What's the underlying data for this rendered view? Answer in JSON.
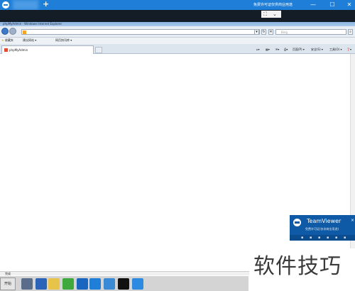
{
  "remote_toolbar": {
    "plus_label": "+",
    "title": "免费许可证仅供商业用途",
    "minimize": "—",
    "maximize": "☐",
    "close": "✕"
  },
  "remote_controls": {
    "scale": "⛶",
    "collapse": "⌄"
  },
  "ie": {
    "window_title": "phpMyAdmin - Windows Internet Explorer",
    "search_placeholder": "Bing",
    "favorites": {
      "favorites_label": "收藏夹",
      "suggested_sites": "建议网站 ▾",
      "web_slice_gallery": "网页快讯库 ▾"
    },
    "tab_label": "phpMyAdmin",
    "commands": {
      "page": "页面(P) ▾",
      "safety": "安全(S) ▾",
      "tools": "工具(O) ▾",
      "help": "❓▾"
    },
    "status_text": "完成"
  },
  "taskbar": {
    "start_label": "开始",
    "icons": [
      {
        "name": "server-manager-icon",
        "color": "#5a6d8a"
      },
      {
        "name": "powershell-icon",
        "color": "#2a63b8"
      },
      {
        "name": "explorer-icon",
        "color": "#e8c34a"
      },
      {
        "name": "green-app-icon",
        "color": "#3eaa3e"
      },
      {
        "name": "outlook-icon",
        "color": "#1a65c0"
      },
      {
        "name": "teamviewer-icon",
        "color": "#1f7fd8"
      },
      {
        "name": "remote-desktop-icon",
        "color": "#3a8ad6"
      },
      {
        "name": "cmd-icon",
        "color": "#111111"
      },
      {
        "name": "ie-icon",
        "color": "#2c8be0"
      }
    ]
  },
  "teamviewer_popup": {
    "name": "TeamViewer",
    "subtitle": "免费许可证(仅非商业用途)",
    "close": "×"
  },
  "watermark": "软件技巧"
}
